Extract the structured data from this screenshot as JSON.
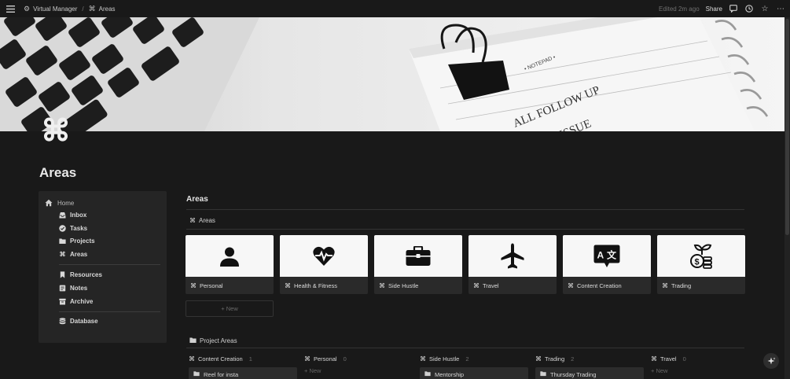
{
  "topbar": {
    "workspace": "Virtual Manager",
    "page": "Areas",
    "edited": "Edited 2m ago",
    "share": "Share"
  },
  "page": {
    "title": "Areas",
    "icon": "command-icon"
  },
  "sidebar": {
    "home": "Home",
    "items": [
      {
        "label": "Inbox",
        "icon": "inbox-icon"
      },
      {
        "label": "Tasks",
        "icon": "check-circle-icon"
      },
      {
        "label": "Projects",
        "icon": "folder-icon"
      },
      {
        "label": "Areas",
        "icon": "command-icon"
      },
      {
        "label": "Resources",
        "icon": "bookmark-icon"
      },
      {
        "label": "Notes",
        "icon": "notes-icon"
      },
      {
        "label": "Archive",
        "icon": "archive-icon"
      },
      {
        "label": "Database",
        "icon": "database-icon"
      }
    ]
  },
  "main": {
    "heading": "Areas",
    "gallery_title": "Areas",
    "cards": [
      {
        "label": "Personal",
        "icon": "person-icon"
      },
      {
        "label": "Health & Fitness",
        "icon": "heart-pulse-icon"
      },
      {
        "label": "Side Hustle",
        "icon": "briefcase-icon"
      },
      {
        "label": "Travel",
        "icon": "airplane-icon"
      },
      {
        "label": "Content Creation",
        "icon": "translate-icon"
      },
      {
        "label": "Trading",
        "icon": "money-plant-icon"
      }
    ],
    "new_label": "+ New",
    "board_title": "Project Areas",
    "columns": [
      {
        "name": "Content Creation",
        "count": "1",
        "card": "Reel for insta"
      },
      {
        "name": "Personal",
        "count": "0",
        "new": "+ New"
      },
      {
        "name": "Side Hustle",
        "count": "2",
        "card": "Mentorship"
      },
      {
        "name": "Trading",
        "count": "2",
        "card": "Thursday Trading"
      },
      {
        "name": "Travel",
        "count": "0",
        "new": "+ New"
      }
    ]
  },
  "colors": {
    "background": "#191919",
    "panel": "#252525",
    "card_image": "#f7f7f7"
  }
}
